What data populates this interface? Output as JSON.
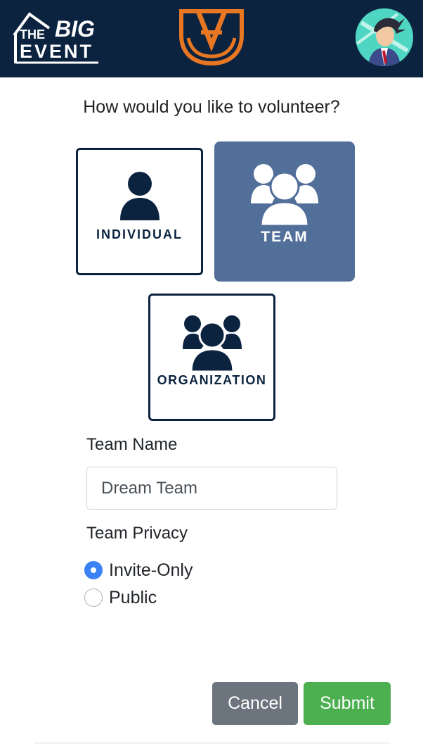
{
  "header": {
    "logo_big_event": {
      "line1": "THE",
      "line2": "BIG",
      "line3": "EVENT"
    },
    "logo_au": {
      "text": "AU"
    },
    "avatar_alt": "user-avatar"
  },
  "question": "How would you like to volunteer?",
  "options": [
    {
      "key": "individual",
      "label": "INDIVIDUAL",
      "icon": "person-icon",
      "selected": false
    },
    {
      "key": "team",
      "label": "TEAM",
      "icon": "team-icon",
      "selected": true
    },
    {
      "key": "organization",
      "label": "ORGANIZATION",
      "icon": "organization-icon",
      "selected": false
    }
  ],
  "form": {
    "team_name_label": "Team Name",
    "team_name_value": "Dream Team",
    "team_privacy_label": "Team Privacy",
    "privacy_options": [
      {
        "label": "Invite-Only",
        "checked": true
      },
      {
        "label": "Public",
        "checked": false
      }
    ]
  },
  "actions": {
    "cancel_label": "Cancel",
    "submit_label": "Submit"
  },
  "colors": {
    "navy": "#0c2340",
    "orange": "#e87722",
    "team_selected": "#526f9a",
    "cancel": "#6c757d",
    "submit": "#4caf50",
    "radio_checked": "#3b82f6"
  }
}
